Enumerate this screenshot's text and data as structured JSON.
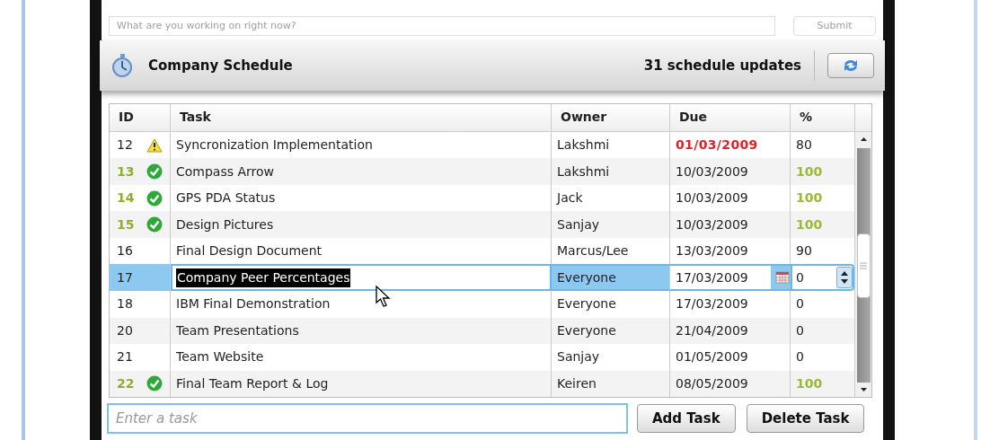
{
  "top_bar": {
    "placeholder": "What are you working on right now?",
    "button": "Submit"
  },
  "header": {
    "title": "Company Schedule",
    "updates": "31 schedule updates"
  },
  "table": {
    "columns": [
      "ID",
      "Task",
      "Owner",
      "Due",
      "%"
    ],
    "rows": [
      {
        "id": "12",
        "kind": "warning",
        "task": "Syncronization Implementation",
        "owner": "Lakshmi",
        "due": "01/03/2009",
        "overdue": true,
        "percent": "80",
        "selected": false
      },
      {
        "id": "13",
        "kind": "done",
        "task": "Compass Arrow",
        "owner": "Lakshmi",
        "due": "10/03/2009",
        "overdue": false,
        "percent": "100",
        "selected": false
      },
      {
        "id": "14",
        "kind": "done",
        "task": "GPS PDA Status",
        "owner": "Jack",
        "due": "10/03/2009",
        "overdue": false,
        "percent": "100",
        "selected": false
      },
      {
        "id": "15",
        "kind": "done",
        "task": "Design Pictures",
        "owner": "Sanjay",
        "due": "10/03/2009",
        "overdue": false,
        "percent": "100",
        "selected": false
      },
      {
        "id": "16",
        "kind": "plain",
        "task": "Final Design Document",
        "owner": "Marcus/Lee",
        "due": "13/03/2009",
        "overdue": false,
        "percent": "90",
        "selected": false
      },
      {
        "id": "17",
        "kind": "plain",
        "task": "Company Peer Percentages",
        "owner": "Everyone",
        "due": "17/03/2009",
        "overdue": false,
        "percent": "0",
        "selected": true
      },
      {
        "id": "18",
        "kind": "plain",
        "task": "IBM Final Demonstration",
        "owner": "Everyone",
        "due": "17/03/2009",
        "overdue": false,
        "percent": "0",
        "selected": false
      },
      {
        "id": "20",
        "kind": "plain",
        "task": "Team Presentations",
        "owner": "Everyone",
        "due": "21/04/2009",
        "overdue": false,
        "percent": "0",
        "selected": false
      },
      {
        "id": "21",
        "kind": "plain",
        "task": "Team Website",
        "owner": "Sanjay",
        "due": "01/05/2009",
        "overdue": false,
        "percent": "0",
        "selected": false
      },
      {
        "id": "22",
        "kind": "done",
        "task": "Final Team Report & Log",
        "owner": "Keiren",
        "due": "08/05/2009",
        "overdue": false,
        "percent": "100",
        "selected": false
      }
    ]
  },
  "footer": {
    "placeholder": "Enter a task",
    "buttons": [
      "Add Task",
      "Delete Task"
    ]
  }
}
